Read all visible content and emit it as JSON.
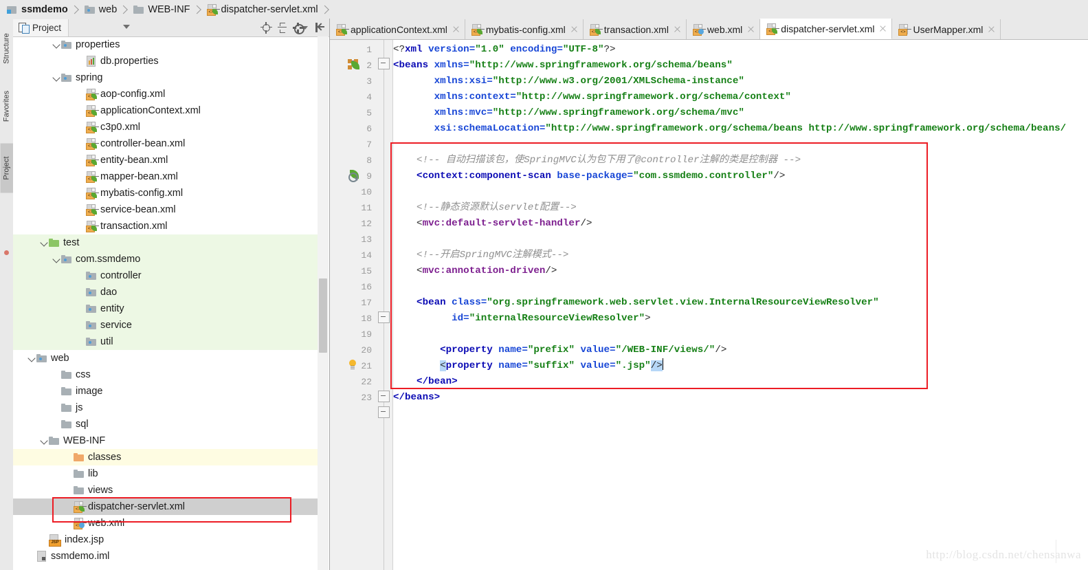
{
  "breadcrumb": {
    "items": [
      {
        "label": "ssmdemo",
        "icon": "module-icon",
        "bold": true
      },
      {
        "label": "web",
        "icon": "folder-icon",
        "bold": false
      },
      {
        "label": "WEB-INF",
        "icon": "folder-plain-icon",
        "bold": false
      },
      {
        "label": "dispatcher-servlet.xml",
        "icon": "xml-file-icon",
        "bold": false
      }
    ]
  },
  "tool_strip": {
    "tabs": [
      "Structure",
      "Favorites",
      "Project"
    ]
  },
  "project_panel": {
    "tab_label": "Project",
    "toolbar": [
      "locate-icon",
      "collapse-all-icon",
      "settings-gear-icon",
      "hide-panel-icon"
    ],
    "tree": [
      {
        "label": "properties",
        "icon": "folder-icon",
        "indent": 4,
        "arrow": "open",
        "state": "normal"
      },
      {
        "label": "db.properties",
        "icon": "properties-file-icon",
        "indent": 6,
        "arrow": "none",
        "state": "normal"
      },
      {
        "label": "spring",
        "icon": "folder-icon",
        "indent": 4,
        "arrow": "open",
        "state": "normal"
      },
      {
        "label": "aop-config.xml",
        "icon": "xml-file-icon",
        "indent": 6,
        "arrow": "none",
        "state": "normal"
      },
      {
        "label": "applicationContext.xml",
        "icon": "xml-file-icon",
        "indent": 6,
        "arrow": "none",
        "state": "normal"
      },
      {
        "label": "c3p0.xml",
        "icon": "xml-file-icon",
        "indent": 6,
        "arrow": "none",
        "state": "normal"
      },
      {
        "label": "controller-bean.xml",
        "icon": "xml-file-icon",
        "indent": 6,
        "arrow": "none",
        "state": "normal"
      },
      {
        "label": "entity-bean.xml",
        "icon": "xml-file-icon",
        "indent": 6,
        "arrow": "none",
        "state": "normal"
      },
      {
        "label": "mapper-bean.xml",
        "icon": "xml-file-icon",
        "indent": 6,
        "arrow": "none",
        "state": "normal"
      },
      {
        "label": "mybatis-config.xml",
        "icon": "xml-file-icon",
        "indent": 6,
        "arrow": "none",
        "state": "normal"
      },
      {
        "label": "service-bean.xml",
        "icon": "xml-file-icon",
        "indent": 6,
        "arrow": "none",
        "state": "normal"
      },
      {
        "label": "transaction.xml",
        "icon": "xml-file-icon",
        "indent": 6,
        "arrow": "none",
        "state": "normal"
      },
      {
        "label": "test",
        "icon": "folder-green-icon",
        "indent": 3,
        "arrow": "open",
        "state": "green"
      },
      {
        "label": "com.ssmdemo",
        "icon": "folder-icon",
        "indent": 4,
        "arrow": "open",
        "state": "green"
      },
      {
        "label": "controller",
        "icon": "folder-icon",
        "indent": 6,
        "arrow": "none",
        "state": "green"
      },
      {
        "label": "dao",
        "icon": "folder-icon",
        "indent": 6,
        "arrow": "none",
        "state": "green"
      },
      {
        "label": "entity",
        "icon": "folder-icon",
        "indent": 6,
        "arrow": "none",
        "state": "green"
      },
      {
        "label": "service",
        "icon": "folder-icon",
        "indent": 6,
        "arrow": "none",
        "state": "green"
      },
      {
        "label": "util",
        "icon": "folder-icon",
        "indent": 6,
        "arrow": "none",
        "state": "green"
      },
      {
        "label": "web",
        "icon": "folder-icon",
        "indent": 2,
        "arrow": "open",
        "state": "normal"
      },
      {
        "label": "css",
        "icon": "folder-plain-icon",
        "indent": 4,
        "arrow": "none",
        "state": "normal"
      },
      {
        "label": "image",
        "icon": "folder-plain-icon",
        "indent": 4,
        "arrow": "none",
        "state": "normal"
      },
      {
        "label": "js",
        "icon": "folder-plain-icon",
        "indent": 4,
        "arrow": "none",
        "state": "normal"
      },
      {
        "label": "sql",
        "icon": "folder-plain-icon",
        "indent": 4,
        "arrow": "none",
        "state": "normal"
      },
      {
        "label": "WEB-INF",
        "icon": "folder-plain-icon",
        "indent": 3,
        "arrow": "open",
        "state": "normal"
      },
      {
        "label": "classes",
        "icon": "folder-orange-icon",
        "indent": 5,
        "arrow": "none",
        "state": "yellow"
      },
      {
        "label": "lib",
        "icon": "folder-plain-icon",
        "indent": 5,
        "arrow": "none",
        "state": "normal"
      },
      {
        "label": "views",
        "icon": "folder-plain-icon",
        "indent": 5,
        "arrow": "none",
        "state": "normal"
      },
      {
        "label": "dispatcher-servlet.xml",
        "icon": "xml-file-icon",
        "indent": 5,
        "arrow": "none",
        "state": "selected"
      },
      {
        "label": "web.xml",
        "icon": "xml-file-blue-icon",
        "indent": 5,
        "arrow": "none",
        "state": "normal"
      },
      {
        "label": "index.jsp",
        "icon": "jsp-file-icon",
        "indent": 3,
        "arrow": "none",
        "state": "normal"
      },
      {
        "label": "ssmdemo.iml",
        "icon": "iml-file-icon",
        "indent": 2,
        "arrow": "none",
        "state": "normal"
      }
    ]
  },
  "editor": {
    "tabs": [
      {
        "label": "applicationContext.xml",
        "icon": "xml-file-icon",
        "active": false
      },
      {
        "label": "mybatis-config.xml",
        "icon": "xml-file-icon",
        "active": false
      },
      {
        "label": "transaction.xml",
        "icon": "xml-file-icon",
        "active": false
      },
      {
        "label": "web.xml",
        "icon": "xml-file-blue-icon",
        "active": false
      },
      {
        "label": "dispatcher-servlet.xml",
        "icon": "xml-file-icon",
        "active": true
      },
      {
        "label": "UserMapper.xml",
        "icon": "xml-file-plain-icon",
        "active": false
      }
    ],
    "line_numbers": [
      1,
      2,
      3,
      4,
      5,
      6,
      7,
      8,
      9,
      10,
      11,
      12,
      13,
      14,
      15,
      16,
      17,
      18,
      19,
      20,
      21,
      22,
      23
    ],
    "gutter_icons": [
      {
        "line": 2,
        "icon": "spring-bean-icon"
      },
      {
        "line": 9,
        "icon": "spring-bean-search-icon"
      },
      {
        "line": 21,
        "icon": "intention-bulb-icon"
      }
    ],
    "code_lines": [
      "<?xml version=\"1.0\" encoding=\"UTF-8\"?>",
      "<beans xmlns=\"http://www.springframework.org/schema/beans\"",
      "       xmlns:xsi=\"http://www.w3.org/2001/XMLSchema-instance\"",
      "       xmlns:context=\"http://www.springframework.org/schema/context\"",
      "       xmlns:mvc=\"http://www.springframework.org/schema/mvc\"",
      "       xsi:schemaLocation=\"http://www.springframework.org/schema/beans http://www.springframework.org/schema/beans",
      "",
      "    <!-- 自动扫描该包，使SpringMVC认为包下用了@controller注解的类是控制器 -->",
      "    <context:component-scan base-package=\"com.ssmdemo.controller\"/>",
      "",
      "    <!--静态资源默认servlet配置-->",
      "    <mvc:default-servlet-handler/>",
      "",
      "    <!--开启SpringMVC注解模式-->",
      "    <mvc:annotation-driven/>",
      "",
      "    <bean class=\"org.springframework.web.servlet.view.InternalResourceViewResolver\"",
      "          id=\"internalResourceViewResolver\">",
      "",
      "        <property name=\"prefix\" value=\"/WEB-INF/views/\"/>",
      "        <property name=\"suffix\" value=\".jsp\"/>",
      "    </bean>",
      "</beans>"
    ],
    "caret_line": 21,
    "highlight_box_label": "red-annotation-rectangle"
  },
  "watermark": {
    "text": "http://blog.csdn.net/chensanwa"
  },
  "colors": {
    "accent_red": "#ec1c24",
    "tag_blue": "#0a0ab4",
    "attr_blue": "#1746d6",
    "value_green": "#168016",
    "comment_grey": "#8f8f8f",
    "mvc_purple": "#7d1f8f",
    "test_green_bg": "#edf8e4",
    "classes_yellow_bg": "#fefce2",
    "selected_grey_bg": "#cfcfcf"
  }
}
